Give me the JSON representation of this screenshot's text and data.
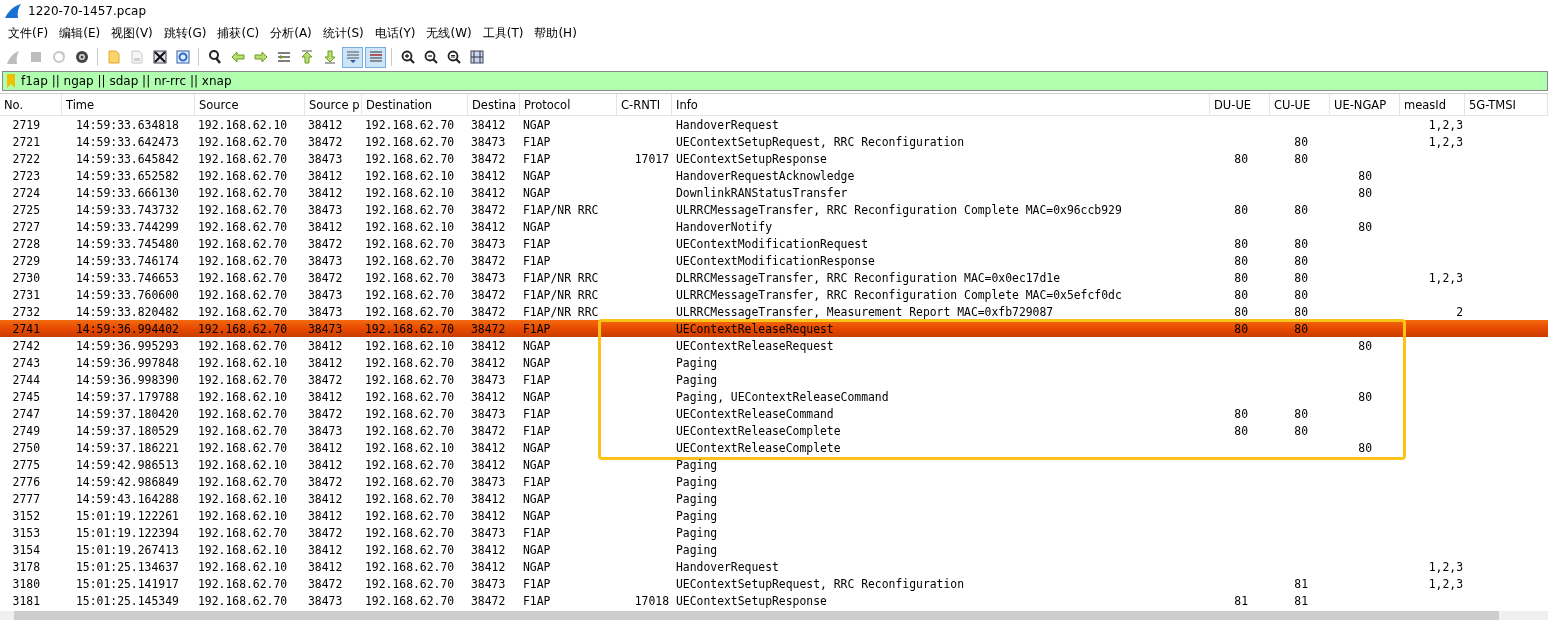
{
  "window": {
    "title": "1220-70-1457.pcap"
  },
  "menu": [
    "文件(F)",
    "编辑(E)",
    "视图(V)",
    "跳转(G)",
    "捕获(C)",
    "分析(A)",
    "统计(S)",
    "电话(Y)",
    "无线(W)",
    "工具(T)",
    "帮助(H)"
  ],
  "toolbar_buttons": [
    {
      "disabled": true,
      "pressed": false
    },
    {
      "disabled": true,
      "pressed": false
    },
    {
      "disabled": true,
      "pressed": false
    },
    {
      "disabled": false,
      "pressed": false
    },
    {
      "disabled": false,
      "pressed": false
    },
    {
      "disabled": true,
      "pressed": false
    },
    {
      "disabled": false,
      "pressed": false
    },
    {
      "disabled": false,
      "pressed": false
    },
    {
      "disabled": false,
      "pressed": false
    },
    {
      "disabled": false,
      "pressed": false
    },
    {
      "disabled": false,
      "pressed": false
    },
    {
      "disabled": false,
      "pressed": false
    },
    {
      "disabled": false,
      "pressed": false
    },
    {
      "disabled": false,
      "pressed": false
    },
    {
      "disabled": false,
      "pressed": true
    },
    {
      "disabled": false,
      "pressed": true
    },
    {
      "disabled": false,
      "pressed": false
    },
    {
      "disabled": false,
      "pressed": false
    },
    {
      "disabled": false,
      "pressed": false
    },
    {
      "disabled": false,
      "pressed": false
    }
  ],
  "filter": {
    "value": "f1ap || ngap || sdap || nr-rrc || xnap"
  },
  "table": {
    "columns": [
      "No.",
      "Time",
      "Source",
      "Source p",
      "Destination",
      "Destina",
      "Protocol",
      "C-RNTI",
      "Info",
      "DU-UE",
      "CU-UE",
      "UE-NGAP",
      "measId",
      "5G-TMSI"
    ],
    "rows": [
      {
        "selected": false,
        "outlined": false,
        "cells": [
          "2719",
          "14:59:33.634818",
          "192.168.62.10",
          "38412",
          "192.168.62.70",
          "38412",
          "NGAP",
          "",
          "HandoverRequest",
          "",
          "",
          "",
          "1,2,3",
          ""
        ]
      },
      {
        "selected": false,
        "outlined": false,
        "cells": [
          "2721",
          "14:59:33.642473",
          "192.168.62.70",
          "38472",
          "192.168.62.70",
          "38473",
          "F1AP",
          "",
          "UEContextSetupRequest, RRC Reconfiguration",
          "",
          "80",
          "",
          "1,2,3",
          ""
        ]
      },
      {
        "selected": false,
        "outlined": false,
        "cells": [
          "2722",
          "14:59:33.645842",
          "192.168.62.70",
          "38473",
          "192.168.62.70",
          "38472",
          "F1AP",
          "17017",
          "UEContextSetupResponse",
          "80",
          "80",
          "",
          "",
          ""
        ]
      },
      {
        "selected": false,
        "outlined": false,
        "cells": [
          "2723",
          "14:59:33.652582",
          "192.168.62.70",
          "38412",
          "192.168.62.10",
          "38412",
          "NGAP",
          "",
          "HandoverRequestAcknowledge",
          "",
          "",
          "80",
          "",
          ""
        ]
      },
      {
        "selected": false,
        "outlined": false,
        "cells": [
          "2724",
          "14:59:33.666130",
          "192.168.62.70",
          "38412",
          "192.168.62.10",
          "38412",
          "NGAP",
          "",
          "DownlinkRANStatusTransfer",
          "",
          "",
          "80",
          "",
          ""
        ]
      },
      {
        "selected": false,
        "outlined": false,
        "cells": [
          "2725",
          "14:59:33.743732",
          "192.168.62.70",
          "38473",
          "192.168.62.70",
          "38472",
          "F1AP/NR RRC",
          "",
          "ULRRCMessageTransfer, RRC Reconfiguration Complete MAC=0x96ccb929",
          "80",
          "80",
          "",
          "",
          ""
        ]
      },
      {
        "selected": false,
        "outlined": false,
        "cells": [
          "2727",
          "14:59:33.744299",
          "192.168.62.70",
          "38412",
          "192.168.62.10",
          "38412",
          "NGAP",
          "",
          "HandoverNotify",
          "",
          "",
          "80",
          "",
          ""
        ]
      },
      {
        "selected": false,
        "outlined": false,
        "cells": [
          "2728",
          "14:59:33.745480",
          "192.168.62.70",
          "38472",
          "192.168.62.70",
          "38473",
          "F1AP",
          "",
          "UEContextModificationRequest",
          "80",
          "80",
          "",
          "",
          ""
        ]
      },
      {
        "selected": false,
        "outlined": false,
        "cells": [
          "2729",
          "14:59:33.746174",
          "192.168.62.70",
          "38473",
          "192.168.62.70",
          "38472",
          "F1AP",
          "",
          "UEContextModificationResponse",
          "80",
          "80",
          "",
          "",
          ""
        ]
      },
      {
        "selected": false,
        "outlined": false,
        "cells": [
          "2730",
          "14:59:33.746653",
          "192.168.62.70",
          "38472",
          "192.168.62.70",
          "38473",
          "F1AP/NR RRC",
          "",
          "DLRRCMessageTransfer, RRC Reconfiguration MAC=0x0ec17d1e",
          "80",
          "80",
          "",
          "1,2,3",
          ""
        ]
      },
      {
        "selected": false,
        "outlined": false,
        "cells": [
          "2731",
          "14:59:33.760600",
          "192.168.62.70",
          "38473",
          "192.168.62.70",
          "38472",
          "F1AP/NR RRC",
          "",
          "ULRRCMessageTransfer, RRC Reconfiguration Complete MAC=0x5efcf0dc",
          "80",
          "80",
          "",
          "",
          ""
        ]
      },
      {
        "selected": false,
        "outlined": false,
        "cells": [
          "2732",
          "14:59:33.820482",
          "192.168.62.70",
          "38473",
          "192.168.62.70",
          "38472",
          "F1AP/NR RRC",
          "",
          "ULRRCMessageTransfer, Measurement Report MAC=0xfb729087",
          "80",
          "80",
          "",
          "2",
          ""
        ]
      },
      {
        "selected": true,
        "outlined": true,
        "cells": [
          "2741",
          "14:59:36.994402",
          "192.168.62.70",
          "38473",
          "192.168.62.70",
          "38472",
          "F1AP",
          "",
          "UEContextReleaseRequest",
          "80",
          "80",
          "",
          "",
          ""
        ]
      },
      {
        "selected": false,
        "outlined": true,
        "cells": [
          "2742",
          "14:59:36.995293",
          "192.168.62.70",
          "38412",
          "192.168.62.10",
          "38412",
          "NGAP",
          "",
          "UEContextReleaseRequest",
          "",
          "",
          "80",
          "",
          ""
        ]
      },
      {
        "selected": false,
        "outlined": true,
        "cells": [
          "2743",
          "14:59:36.997848",
          "192.168.62.10",
          "38412",
          "192.168.62.70",
          "38412",
          "NGAP",
          "",
          "Paging",
          "",
          "",
          "",
          "",
          ""
        ]
      },
      {
        "selected": false,
        "outlined": true,
        "cells": [
          "2744",
          "14:59:36.998390",
          "192.168.62.70",
          "38472",
          "192.168.62.70",
          "38473",
          "F1AP",
          "",
          "Paging",
          "",
          "",
          "",
          "",
          ""
        ]
      },
      {
        "selected": false,
        "outlined": true,
        "cells": [
          "2745",
          "14:59:37.179788",
          "192.168.62.10",
          "38412",
          "192.168.62.70",
          "38412",
          "NGAP",
          "",
          "Paging, UEContextReleaseCommand",
          "",
          "",
          "80",
          "",
          ""
        ]
      },
      {
        "selected": false,
        "outlined": true,
        "cells": [
          "2747",
          "14:59:37.180420",
          "192.168.62.70",
          "38472",
          "192.168.62.70",
          "38473",
          "F1AP",
          "",
          "UEContextReleaseCommand",
          "80",
          "80",
          "",
          "",
          ""
        ]
      },
      {
        "selected": false,
        "outlined": true,
        "cells": [
          "2749",
          "14:59:37.180529",
          "192.168.62.70",
          "38473",
          "192.168.62.70",
          "38472",
          "F1AP",
          "",
          "UEContextReleaseComplete",
          "80",
          "80",
          "",
          "",
          ""
        ]
      },
      {
        "selected": false,
        "outlined": true,
        "cells": [
          "2750",
          "14:59:37.186221",
          "192.168.62.70",
          "38412",
          "192.168.62.10",
          "38412",
          "NGAP",
          "",
          "UEContextReleaseComplete",
          "",
          "",
          "80",
          "",
          ""
        ]
      },
      {
        "selected": false,
        "outlined": false,
        "cells": [
          "2775",
          "14:59:42.986513",
          "192.168.62.10",
          "38412",
          "192.168.62.70",
          "38412",
          "NGAP",
          "",
          "Paging",
          "",
          "",
          "",
          "",
          ""
        ]
      },
      {
        "selected": false,
        "outlined": false,
        "cells": [
          "2776",
          "14:59:42.986849",
          "192.168.62.70",
          "38472",
          "192.168.62.70",
          "38473",
          "F1AP",
          "",
          "Paging",
          "",
          "",
          "",
          "",
          ""
        ]
      },
      {
        "selected": false,
        "outlined": false,
        "cells": [
          "2777",
          "14:59:43.164288",
          "192.168.62.10",
          "38412",
          "192.168.62.70",
          "38412",
          "NGAP",
          "",
          "Paging",
          "",
          "",
          "",
          "",
          ""
        ]
      },
      {
        "selected": false,
        "outlined": false,
        "cells": [
          "3152",
          "15:01:19.122261",
          "192.168.62.10",
          "38412",
          "192.168.62.70",
          "38412",
          "NGAP",
          "",
          "Paging",
          "",
          "",
          "",
          "",
          ""
        ]
      },
      {
        "selected": false,
        "outlined": false,
        "cells": [
          "3153",
          "15:01:19.122394",
          "192.168.62.70",
          "38472",
          "192.168.62.70",
          "38473",
          "F1AP",
          "",
          "Paging",
          "",
          "",
          "",
          "",
          ""
        ]
      },
      {
        "selected": false,
        "outlined": false,
        "cells": [
          "3154",
          "15:01:19.267413",
          "192.168.62.10",
          "38412",
          "192.168.62.70",
          "38412",
          "NGAP",
          "",
          "Paging",
          "",
          "",
          "",
          "",
          ""
        ]
      },
      {
        "selected": false,
        "outlined": false,
        "cells": [
          "3178",
          "15:01:25.134637",
          "192.168.62.10",
          "38412",
          "192.168.62.70",
          "38412",
          "NGAP",
          "",
          "HandoverRequest",
          "",
          "",
          "",
          "1,2,3",
          ""
        ]
      },
      {
        "selected": false,
        "outlined": false,
        "cells": [
          "3180",
          "15:01:25.141917",
          "192.168.62.70",
          "38472",
          "192.168.62.70",
          "38473",
          "F1AP",
          "",
          "UEContextSetupRequest, RRC Reconfiguration",
          "",
          "81",
          "",
          "1,2,3",
          ""
        ]
      },
      {
        "selected": false,
        "outlined": false,
        "cells": [
          "3181",
          "15:01:25.145349",
          "192.168.62.70",
          "38473",
          "192.168.62.70",
          "38472",
          "F1AP",
          "17018",
          "UEContextSetupResponse",
          "81",
          "81",
          "",
          "",
          ""
        ]
      }
    ]
  }
}
